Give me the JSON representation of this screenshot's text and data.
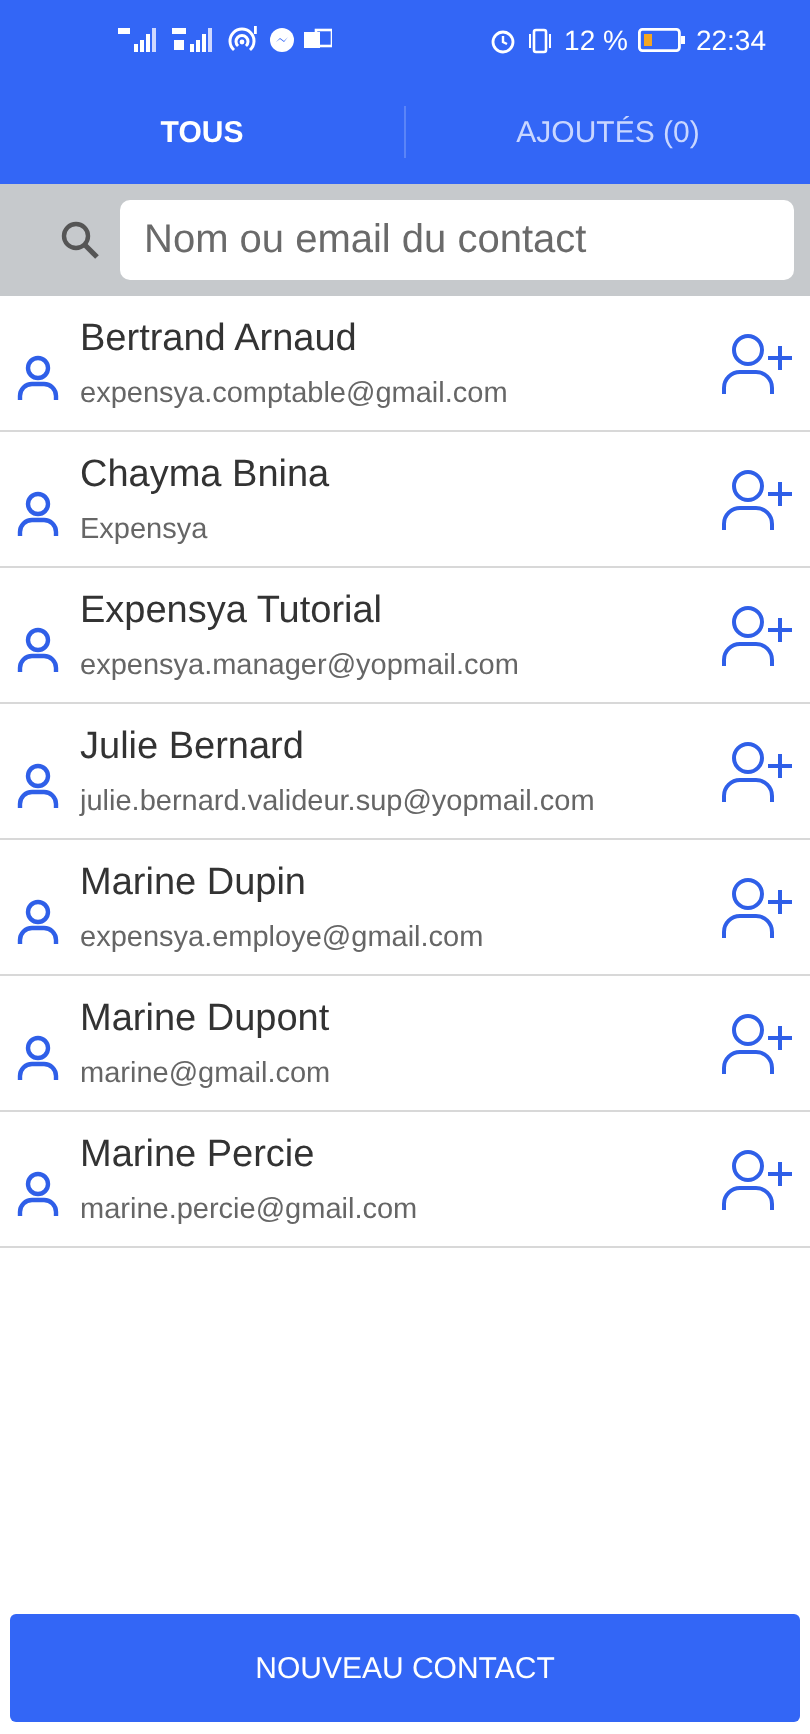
{
  "status_bar": {
    "battery_percent": "12 %",
    "time": "22:34"
  },
  "tabs": [
    {
      "label": "TOUS",
      "selected": true
    },
    {
      "label": "AJOUTÉS (0)",
      "selected": false
    }
  ],
  "search": {
    "placeholder": "Nom ou email du contact"
  },
  "contacts": [
    {
      "name": "Bertrand Arnaud",
      "detail": "expensya.comptable@gmail.com"
    },
    {
      "name": "Chayma Bnina",
      "detail": "Expensya"
    },
    {
      "name": "Expensya Tutorial",
      "detail": "expensya.manager@yopmail.com"
    },
    {
      "name": "Julie Bernard",
      "detail": "julie.bernard.valideur.sup@yopmail.com"
    },
    {
      "name": "Marine Dupin",
      "detail": "expensya.employe@gmail.com"
    },
    {
      "name": "Marine Dupont",
      "detail": "marine@gmail.com"
    },
    {
      "name": "Marine Percie",
      "detail": "marine.percie@gmail.com"
    }
  ],
  "primary_button": "NOUVEAU CONTACT"
}
